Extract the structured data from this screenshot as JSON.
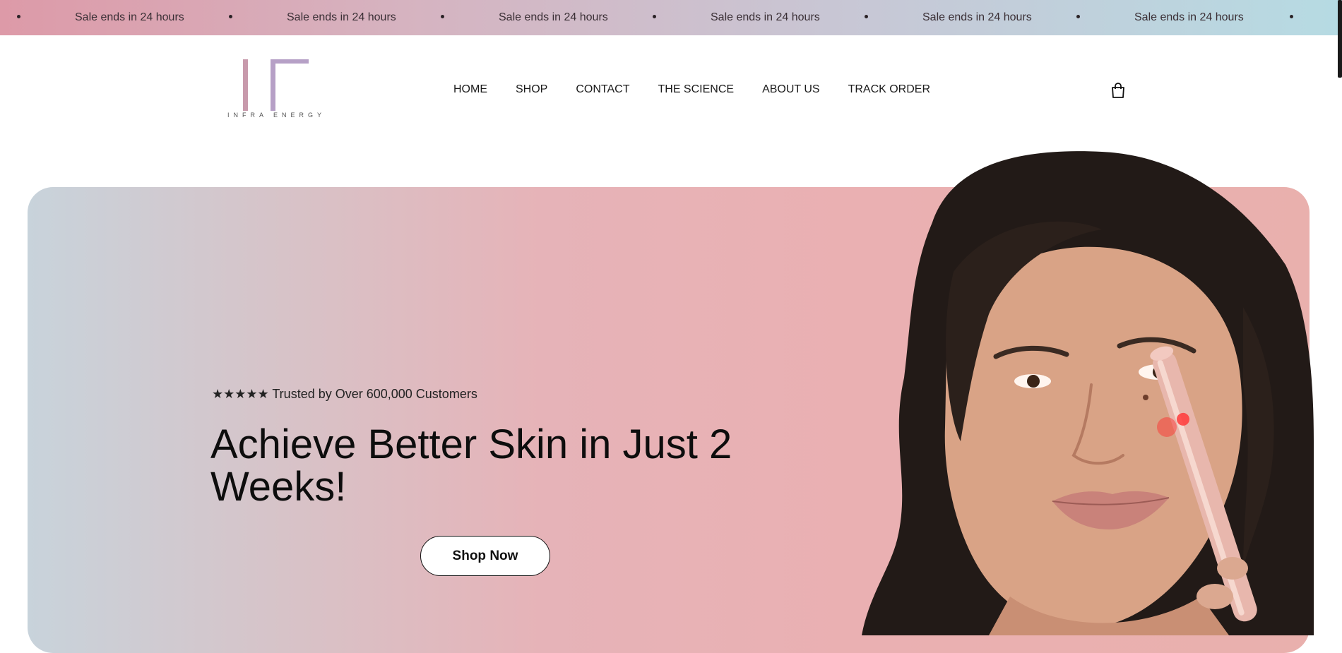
{
  "announcement": {
    "text": "Sale ends in 24 hours",
    "repeats": 6
  },
  "header": {
    "logo_text": "INFRA ENERGY",
    "nav": [
      {
        "label": "HOME"
      },
      {
        "label": "SHOP"
      },
      {
        "label": "CONTACT"
      },
      {
        "label": "THE SCIENCE"
      },
      {
        "label": "ABOUT US"
      },
      {
        "label": "TRACK ORDER"
      }
    ],
    "cart_icon": "shopping-bag-icon"
  },
  "hero": {
    "trust_line": "★★★★★ Trusted by Over 600,000 Customers",
    "headline": "Achieve Better Skin in Just 2 Weeks!",
    "cta_label": "Shop Now",
    "image": "woman-using-red-light-wand"
  },
  "colors": {
    "announce_left": "#dd9aa8",
    "announce_right": "#b6dbe3",
    "hero_left": "#c8d3db",
    "hero_right": "#e9b0ad",
    "logo_pink": "#c89aac",
    "logo_lilac": "#b6a0c6"
  }
}
